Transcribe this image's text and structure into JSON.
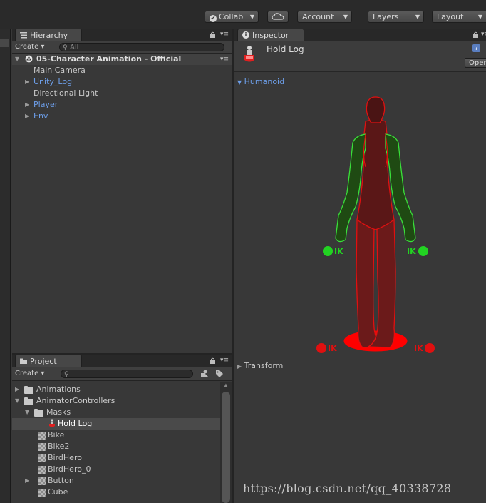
{
  "toolbar": {
    "collab": "Collab",
    "account": "Account",
    "layers": "Layers",
    "layout": "Layout"
  },
  "hierarchy": {
    "tab_title": "Hierarchy",
    "create_label": "Create",
    "search_placeholder": "All",
    "scene_name": "05-Character Animation - Official",
    "items": [
      {
        "label": "Main Camera",
        "expandable": false,
        "prefab": false
      },
      {
        "label": "Unity_Log",
        "expandable": true,
        "prefab": true
      },
      {
        "label": "Directional Light",
        "expandable": false,
        "prefab": false
      },
      {
        "label": "Player",
        "expandable": true,
        "prefab": true
      },
      {
        "label": "Env",
        "expandable": true,
        "prefab": true
      }
    ]
  },
  "project": {
    "tab_title": "Project",
    "create_label": "Create",
    "tree": [
      {
        "label": "Animations",
        "type": "folder",
        "depth": 0,
        "state": "collapsed"
      },
      {
        "label": "AnimatorControllers",
        "type": "folder",
        "depth": 0,
        "state": "expanded"
      },
      {
        "label": "Masks",
        "type": "folder",
        "depth": 1,
        "state": "expanded"
      },
      {
        "label": "Hold Log",
        "type": "avatar-mask",
        "depth": 2,
        "selected": true
      },
      {
        "label": "Bike",
        "type": "controller",
        "depth": 1
      },
      {
        "label": "Bike2",
        "type": "controller",
        "depth": 1
      },
      {
        "label": "BirdHero",
        "type": "controller",
        "depth": 1
      },
      {
        "label": "BirdHero_0",
        "type": "controller",
        "depth": 1
      },
      {
        "label": "Button",
        "type": "controller",
        "depth": 1,
        "state": "collapsed"
      },
      {
        "label": "Cube",
        "type": "controller",
        "depth": 1
      }
    ]
  },
  "inspector": {
    "tab_title": "Inspector",
    "asset_name": "Hold Log",
    "open_button": "Open",
    "humanoid_label": "Humanoid",
    "transform_label": "Transform",
    "ik_label": "IK",
    "colors": {
      "active_green": "#22d322",
      "inactive_red": "#e01010"
    }
  },
  "watermark": "https://blog.csdn.net/qq_40338728"
}
